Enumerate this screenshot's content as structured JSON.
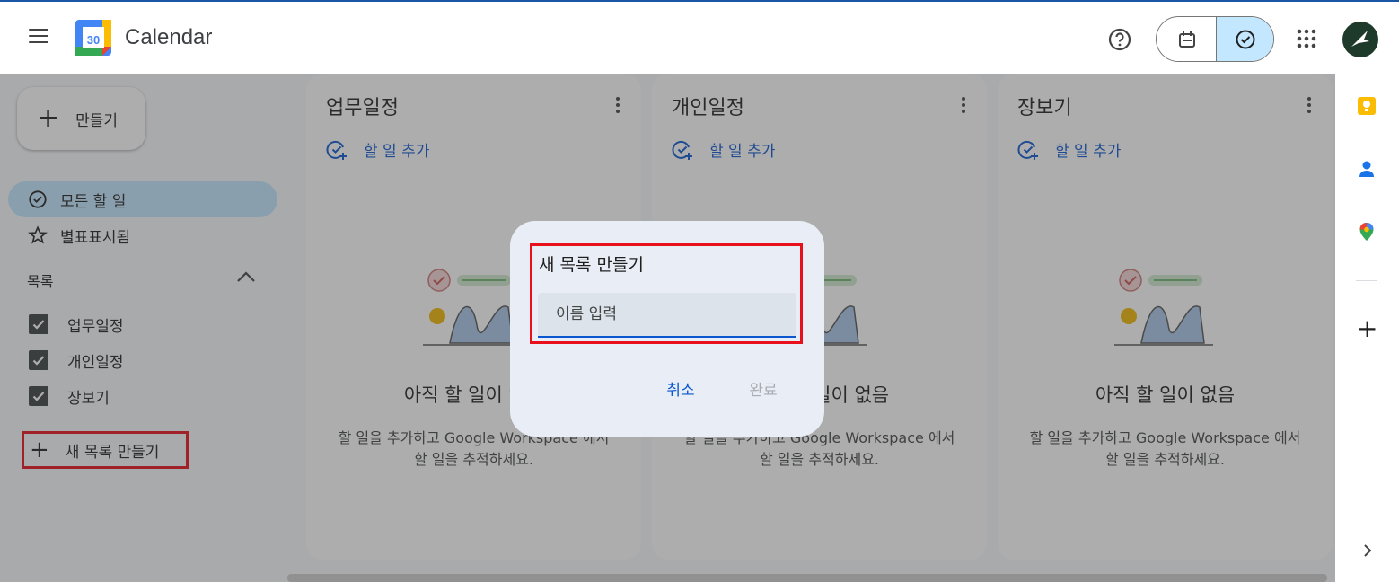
{
  "header": {
    "app_title": "Calendar",
    "logo_day": "30",
    "icons": {
      "menu": "menu-icon",
      "help": "help-icon",
      "calendar_view": "calendar-icon",
      "tasks_view": "task-check-icon",
      "apps": "apps-grid-icon"
    }
  },
  "sidebar": {
    "create_label": "만들기",
    "nav": [
      {
        "label": "모든 할 일",
        "selected": true
      },
      {
        "label": "별표표시됨",
        "selected": false
      }
    ],
    "lists_header": "목록",
    "lists": [
      {
        "label": "업무일정",
        "checked": true
      },
      {
        "label": "개인일정",
        "checked": true
      },
      {
        "label": "장보기",
        "checked": true
      }
    ],
    "new_list_label": "새 목록 만들기"
  },
  "columns": [
    {
      "title": "업무일정",
      "add_label": "할 일 추가",
      "empty_title": "아직 할 일이 없음",
      "empty_desc": "할 일을 추가하고 Google Workspace 에서 할 일을 추적하세요."
    },
    {
      "title": "개인일정",
      "add_label": "할 일 추가",
      "empty_title": "아직 할 일이 없음",
      "empty_desc": "할 일을 추가하고 Google Workspace 에서 할 일을 추적하세요."
    },
    {
      "title": "장보기",
      "add_label": "할 일 추가",
      "empty_title": "아직 할 일이 없음",
      "empty_desc": "할 일을 추가하고 Google Workspace 에서 할 일을 추적하세요."
    }
  ],
  "dialog": {
    "title": "새 목록 만들기",
    "input_placeholder": "이름 입력",
    "input_value": "",
    "cancel_label": "취소",
    "done_label": "완료"
  },
  "rail": {
    "icons": [
      "keep-icon",
      "contacts-icon",
      "maps-icon",
      "add-icon",
      "chevron-right-icon"
    ]
  },
  "colors": {
    "accent": "#0b57d0",
    "selected_bg": "#c2e7ff",
    "highlight": "#e8101a"
  }
}
